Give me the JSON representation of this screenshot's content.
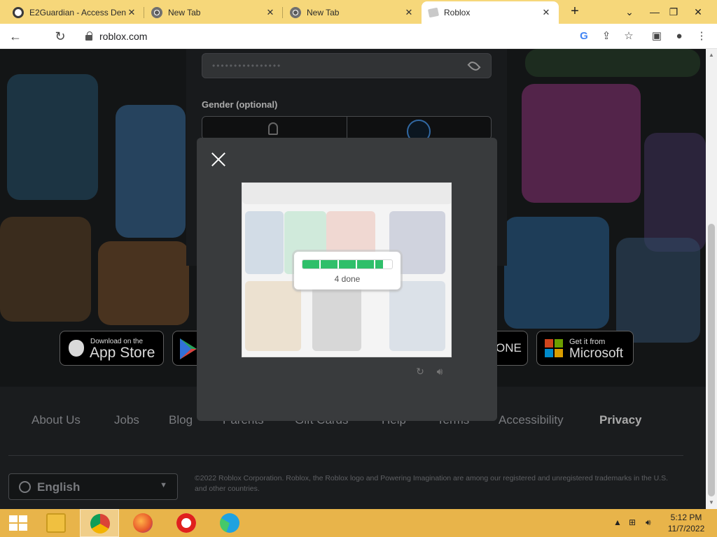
{
  "browser": {
    "tabs": [
      {
        "title": "E2Guardian - Access Den",
        "icon": "shield-favicon"
      },
      {
        "title": "New Tab",
        "icon": "chrome-favicon"
      },
      {
        "title": "New Tab",
        "icon": "chrome-favicon"
      },
      {
        "title": "Roblox",
        "icon": "roblox-favicon"
      }
    ],
    "active_tab_index": 3,
    "url": "roblox.com"
  },
  "signup": {
    "password_mask": "••••••••••••••••",
    "gender_label": "Gender (optional)"
  },
  "stores": {
    "apple_small": "Download on the",
    "apple_big": "App Store",
    "xbox_fragment": "ONE",
    "ms_small": "Get it from",
    "ms_big": "Microsoft"
  },
  "footer": {
    "links": [
      "About Us",
      "Jobs",
      "Blog",
      "Parents",
      "Gift Cards",
      "Help",
      "Terms",
      "Accessibility",
      "Privacy"
    ],
    "language": "English",
    "copyright": "©2022 Roblox Corporation. Roblox, the Roblox logo and Powering Imagination are among our registered and unregistered trademarks in the U.S. and other countries."
  },
  "captcha": {
    "progress_text": "4 done",
    "progress_fraction": 0.9,
    "progress_color": "#2fbf6a"
  },
  "taskbar": {
    "time": "5:12 PM",
    "date": "11/7/2022"
  }
}
